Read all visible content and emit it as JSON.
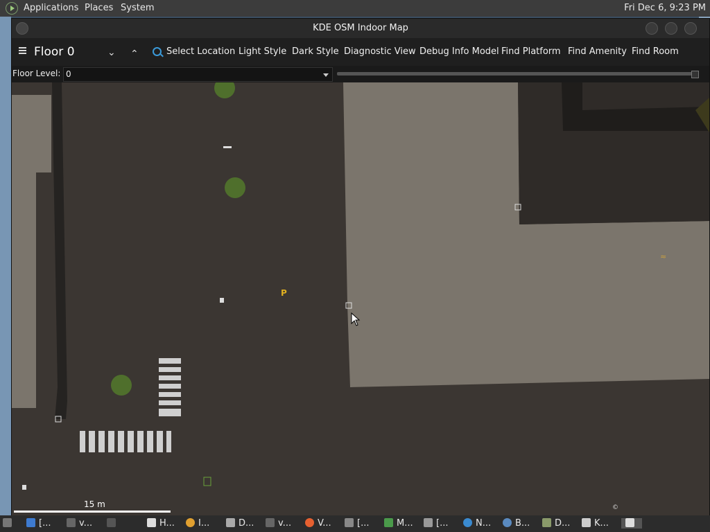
{
  "top_panel": {
    "menus": [
      "Applications",
      "Places",
      "System"
    ],
    "clock": "Fri Dec  6,  9:23 PM"
  },
  "window": {
    "title": "KDE OSM Indoor Map"
  },
  "toolbar": {
    "floor_title": "Floor 0",
    "actions": [
      "Select Location",
      "Light Style",
      "Dark Style",
      "Diagnostic View",
      "Debug Info Model",
      "Find Platform",
      "Find Amenity",
      "Find Room"
    ]
  },
  "floor_level": {
    "label": "Floor Level:",
    "value": "0"
  },
  "map": {
    "scale_label": "15 m",
    "attribution": "©",
    "attribution_link": "",
    "colors": {
      "ground": "#3b3632",
      "building": "#7b756c",
      "dark_building": "#2f2b28",
      "tree": "#4f6f2c"
    },
    "parking_label": "P"
  },
  "taskbar": {
    "items": [
      "[...",
      "v...",
      "",
      "H...",
      "I...",
      "D...",
      "v...",
      "V...",
      "[...",
      "M...",
      "[...",
      "N...",
      "B...",
      "D...",
      "K..."
    ]
  }
}
